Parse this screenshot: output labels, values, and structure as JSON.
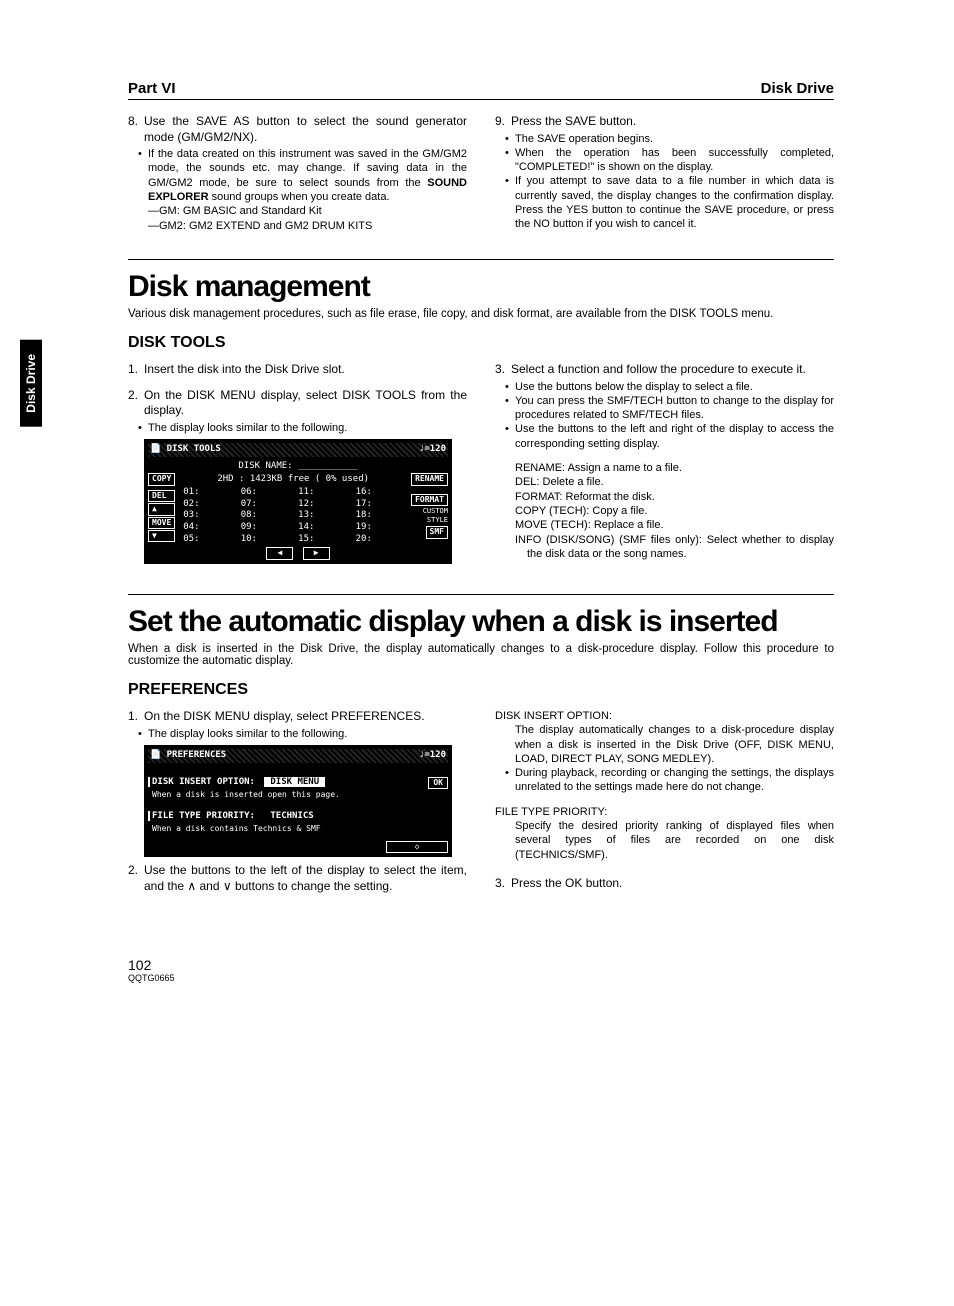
{
  "sideTab": "Disk Drive",
  "header": {
    "left": "Part VI",
    "right": "Disk Drive"
  },
  "topSteps": {
    "left": {
      "num": "8.",
      "text": "Use the SAVE AS button to select the sound generator mode (GM/GM2/NX).",
      "bullets": [
        "If the data created on this instrument was saved in the GM/GM2 mode, the sounds etc. may change. If saving data in the GM/GM2 mode, be sure to select sounds from the SOUND EXPLORER sound groups when you create data."
      ],
      "subs": [
        "—GM: GM BASIC and Standard Kit",
        "—GM2: GM2 EXTEND and GM2 DRUM KITS"
      ]
    },
    "right": {
      "num": "9.",
      "text": "Press the SAVE button.",
      "bullets": [
        "The SAVE operation begins.",
        "When the operation has been successfully completed, \"COMPLETED!\" is shown on the display.",
        "If you attempt to save data to a file number in which data is currently saved, the display changes to the confirmation display. Press the YES button to continue the SAVE procedure, or press the NO button if you wish to cancel it."
      ]
    }
  },
  "diskMgmt": {
    "title": "Disk management",
    "intro": "Various disk management procedures, such as file erase, file copy, and disk format, are available from the DISK TOOLS menu.",
    "subTitle": "DISK TOOLS",
    "leftSteps": [
      {
        "num": "1.",
        "text": "Insert the disk into the Disk Drive slot."
      },
      {
        "num": "2.",
        "text": "On the DISK MENU display, select DISK TOOLS from the display."
      }
    ],
    "leftBullet": "The display looks similar to the following.",
    "screen": {
      "title": "DISK TOOLS",
      "tempo": "♩=120",
      "diskName": "DISK NAME: ___________",
      "diskInfo": "2HD : 1423KB free (   0% used)",
      "leftBtns": [
        "COPY",
        "DEL",
        "▲",
        "MOVE",
        "▼"
      ],
      "rightBtns": [
        "RENAME",
        "FORMAT",
        "CUSTOM",
        "STYLE",
        "SMF"
      ],
      "cols": [
        [
          "01:",
          "02:",
          "03:",
          "04:",
          "05:"
        ],
        [
          "06:",
          "07:",
          "08:",
          "09:",
          "10:"
        ],
        [
          "11:",
          "12:",
          "13:",
          "14:",
          "15:"
        ],
        [
          "16:",
          "17:",
          "18:",
          "19:",
          "20:"
        ]
      ]
    },
    "rightStep": {
      "num": "3.",
      "text": "Select a function and follow the procedure to execute it."
    },
    "rightBullets": [
      "Use the buttons below the display to select a file.",
      "You can press the SMF/TECH button to change to the display for procedures related to SMF/TECH files.",
      "Use the buttons to the left and right of the display to access the corresponding setting display."
    ],
    "defs": [
      "RENAME: Assign a name to a file.",
      "DEL: Delete a file.",
      "FORMAT: Reformat the disk.",
      "COPY (TECH): Copy a file.",
      "MOVE (TECH): Replace a file.",
      "INFO (DISK/SONG) (SMF files only): Select whether to display the disk data or the song names."
    ]
  },
  "autoDisplay": {
    "title": "Set the automatic display when a disk is inserted",
    "intro": "When a disk is inserted in the Disk Drive, the display automatically changes to a disk-procedure display. Follow this procedure to customize the automatic display.",
    "subTitle": "PREFERENCES",
    "leftStep1": {
      "num": "1.",
      "text": "On the DISK MENU display, select PREFERENCES."
    },
    "leftBullet": "The display looks similar to the following.",
    "screen": {
      "title": "PREFERENCES",
      "tempo": "♩=120",
      "opt1Label": "DISK INSERT OPTION:",
      "opt1Value": "DISK MENU",
      "opt1Caption": "When a disk is inserted open this page.",
      "opt2Label": "FILE TYPE PRIORITY:",
      "opt2Value": "TECHNICS",
      "opt2Caption": "When a disk contains Technics & SMF",
      "ok": "OK"
    },
    "leftStep2": {
      "num": "2.",
      "text": "Use the buttons to the left of the display to select the item, and the ∧ and ∨ buttons to change the setting."
    },
    "rightBlocks": [
      {
        "label": "DISK INSERT OPTION:",
        "desc": "The display automatically changes to a disk-procedure display when a disk is inserted in the Disk Drive (OFF, DISK MENU, LOAD, DIRECT PLAY, SONG MEDLEY).",
        "bullet": "During playback, recording or changing the settings, the displays unrelated to the settings made here do not change."
      },
      {
        "label": "FILE TYPE PRIORITY:",
        "desc": "Specify the desired priority ranking of displayed files when several types of files are recorded on one disk (TECHNICS/SMF)."
      }
    ],
    "rightStep3": {
      "num": "3.",
      "text": "Press the OK button."
    }
  },
  "footer": {
    "page": "102",
    "code": "QQTG0665"
  }
}
